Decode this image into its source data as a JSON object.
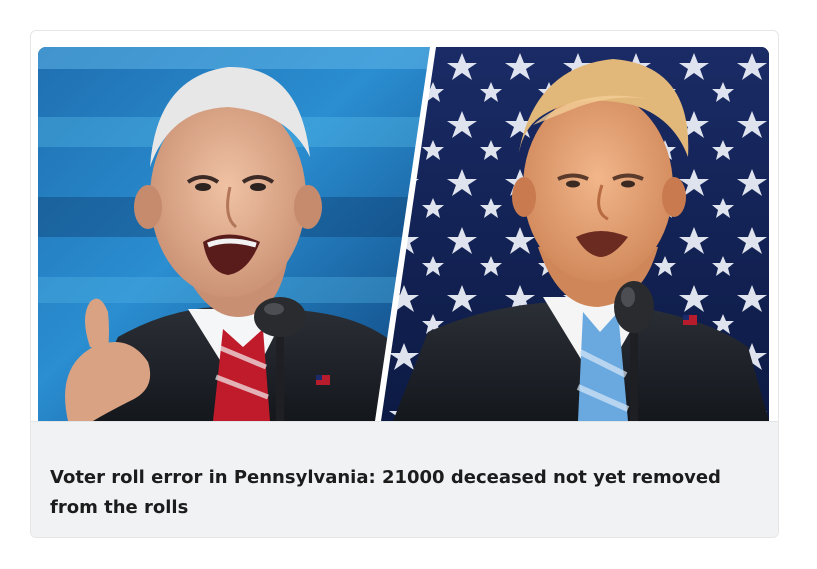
{
  "post": {
    "title": "Voter roll error in Pennsylvania: 21000 deceased not yet removed from the rolls",
    "image": {
      "left_panel": "person speaking at microphone, blue stage background",
      "right_panel": "person speaking at microphone, stars-and-stripes background"
    }
  },
  "colors": {
    "footer_bg": "#f1f2f4",
    "title_text": "#1c1c1c",
    "card_border": "#e6e6e6"
  }
}
